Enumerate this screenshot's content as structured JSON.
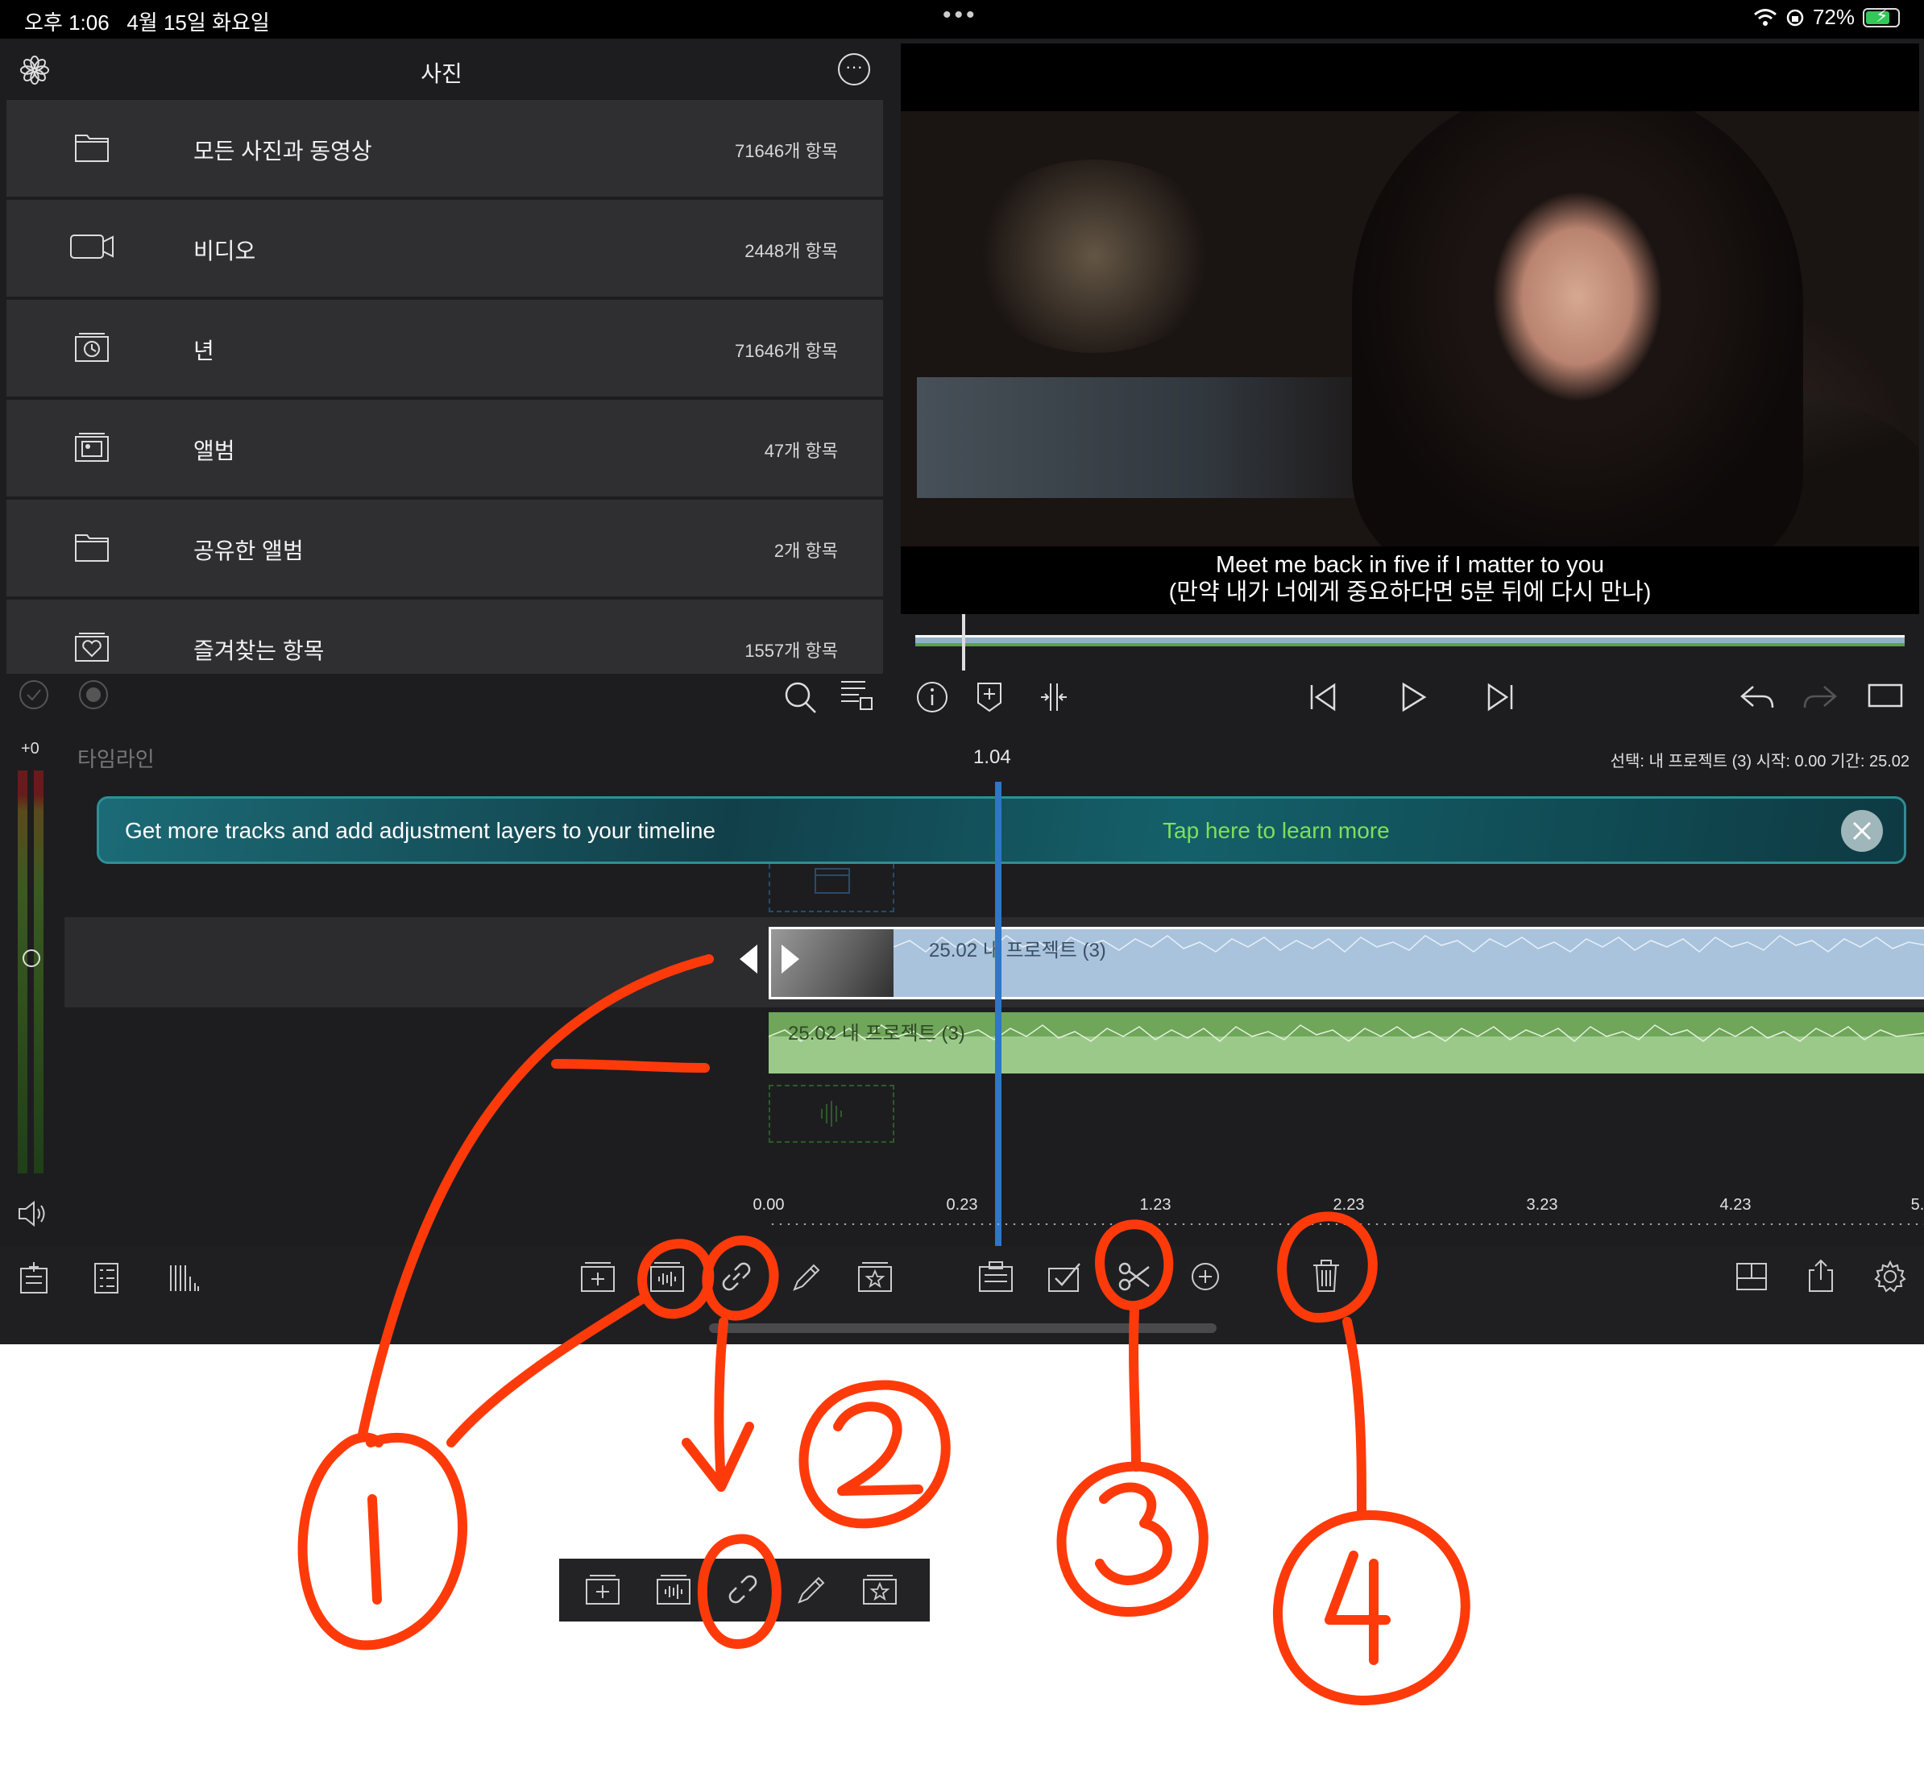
{
  "status_bar": {
    "time": "오후 1:06",
    "date": "4월 15일 화요일",
    "dots": "•••",
    "battery": "72%"
  },
  "media": {
    "title": "사진",
    "more": "···",
    "items": [
      {
        "label": "모든 사진과 동영상",
        "count": "71646개 항목",
        "icon": "folder-icon"
      },
      {
        "label": "비디오",
        "count": "2448개 항목",
        "icon": "video-camera-icon"
      },
      {
        "label": "년",
        "count": "71646개 항목",
        "icon": "clock-stack-icon"
      },
      {
        "label": "앨범",
        "count": "47개 항목",
        "icon": "photo-stack-icon"
      },
      {
        "label": "공유한 앨범",
        "count": "2개 항목",
        "icon": "folder-icon"
      },
      {
        "label": "즐겨찾는 항목",
        "count": "1557개 항목",
        "icon": "heart-stack-icon"
      }
    ]
  },
  "preview": {
    "subtitle_en": "Meet me back in five if I matter to you",
    "subtitle_ko": "(만약 내가 너에게 중요하다면 5분 뒤에 다시 만나)"
  },
  "timeline": {
    "meter_label": "+0",
    "title": "타임라인",
    "playhead_time": "1.04",
    "selection_info": "선택: 내 프로젝트 (3) 시작: 0.00 기간: 25.02",
    "promo_text": "Get more tracks and add adjustment layers to your timeline",
    "promo_link": "Tap here to learn more",
    "video_clip_label": "25.02  내 프로젝트 (3)",
    "audio_clip_label": "25.02  내 프로젝트 (3)",
    "ruler_ticks": [
      "0.00",
      "0.23",
      "1.23",
      "2.23",
      "3.23",
      "4.23",
      "5."
    ]
  },
  "annotations": {
    "numbers": [
      "1",
      "2",
      "3",
      "4"
    ],
    "color": "#ff3a0a"
  },
  "colors": {
    "accent": "#2e76c6",
    "audio_green": "#6fa65a",
    "video_blue": "#a9c3dd",
    "promo_link": "#7ee05a"
  }
}
